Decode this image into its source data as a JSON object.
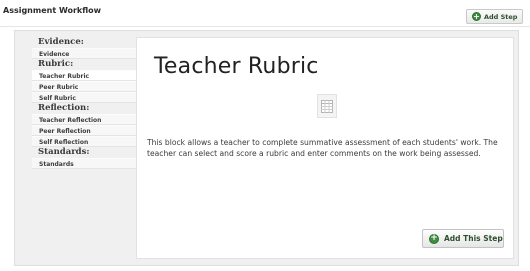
{
  "header": {
    "title": "Assignment Workflow",
    "add_step_label": "Add Step"
  },
  "sidebar": {
    "sections": [
      {
        "heading": "Evidence:",
        "items": [
          "Evidence"
        ]
      },
      {
        "heading": "Rubric:",
        "items": [
          "Teacher Rubric",
          "Peer Rubric",
          "Self Rubric"
        ]
      },
      {
        "heading": "Reflection:",
        "items": [
          "Teacher Reflection",
          "Peer Reflection",
          "Self Reflection"
        ]
      },
      {
        "heading": "Standards:",
        "items": [
          "Standards"
        ]
      }
    ],
    "active_item": "Teacher Rubric"
  },
  "main": {
    "title": "Teacher Rubric",
    "icon": "rubric-grid-icon",
    "description": "This block allows a teacher to complete summative assessment of each students' work. The teacher can select and score a rubric and enter comments on the work being assessed.",
    "add_button_label": "Add This Step"
  },
  "colors": {
    "accent_green": "#3f8f3f",
    "panel_bg": "#f0f0f0"
  }
}
